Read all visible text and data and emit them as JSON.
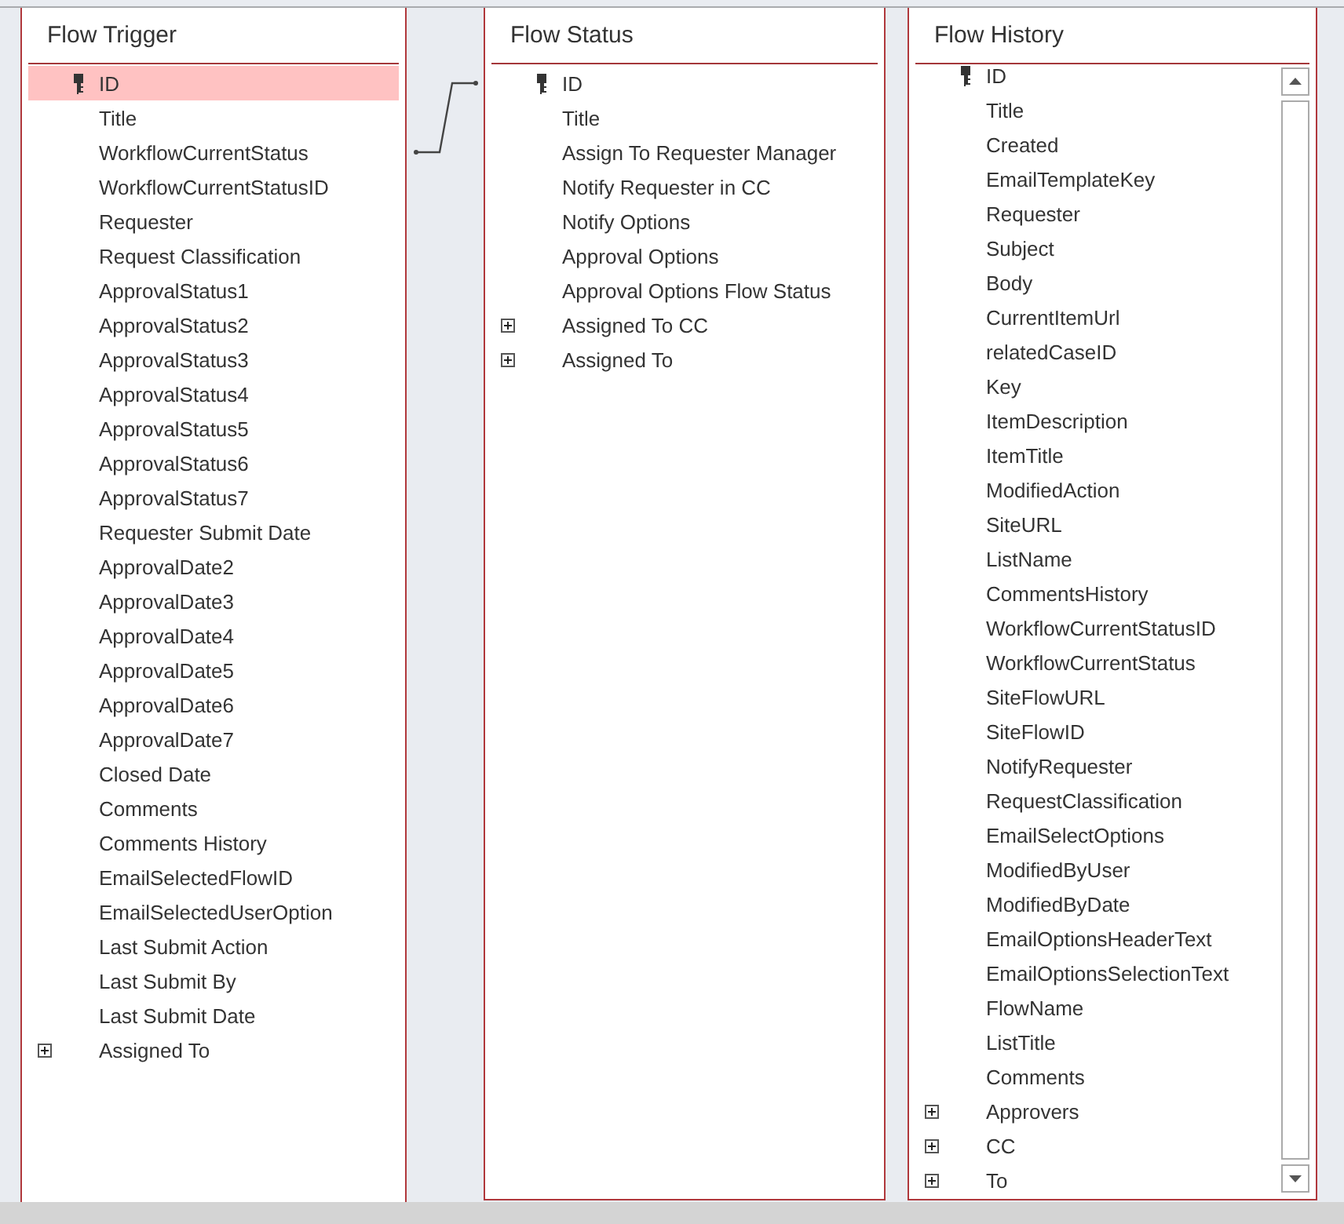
{
  "tables": [
    {
      "title": "Flow Trigger",
      "scrollbar": false,
      "fields": [
        {
          "name": "ID",
          "kind": "key",
          "selected": true
        },
        {
          "name": "Title",
          "kind": "field",
          "selected": false
        },
        {
          "name": "WorkflowCurrentStatus",
          "kind": "field",
          "selected": false
        },
        {
          "name": "WorkflowCurrentStatusID",
          "kind": "field",
          "selected": false
        },
        {
          "name": "Requester",
          "kind": "field",
          "selected": false
        },
        {
          "name": "Request Classification",
          "kind": "field",
          "selected": false
        },
        {
          "name": "ApprovalStatus1",
          "kind": "field",
          "selected": false
        },
        {
          "name": "ApprovalStatus2",
          "kind": "field",
          "selected": false
        },
        {
          "name": "ApprovalStatus3",
          "kind": "field",
          "selected": false
        },
        {
          "name": "ApprovalStatus4",
          "kind": "field",
          "selected": false
        },
        {
          "name": "ApprovalStatus5",
          "kind": "field",
          "selected": false
        },
        {
          "name": "ApprovalStatus6",
          "kind": "field",
          "selected": false
        },
        {
          "name": "ApprovalStatus7",
          "kind": "field",
          "selected": false
        },
        {
          "name": "Requester Submit Date",
          "kind": "field",
          "selected": false
        },
        {
          "name": "ApprovalDate2",
          "kind": "field",
          "selected": false
        },
        {
          "name": "ApprovalDate3",
          "kind": "field",
          "selected": false
        },
        {
          "name": "ApprovalDate4",
          "kind": "field",
          "selected": false
        },
        {
          "name": "ApprovalDate5",
          "kind": "field",
          "selected": false
        },
        {
          "name": "ApprovalDate6",
          "kind": "field",
          "selected": false
        },
        {
          "name": "ApprovalDate7",
          "kind": "field",
          "selected": false
        },
        {
          "name": "Closed Date",
          "kind": "field",
          "selected": false
        },
        {
          "name": "Comments",
          "kind": "field",
          "selected": false
        },
        {
          "name": "Comments History",
          "kind": "field",
          "selected": false
        },
        {
          "name": "EmailSelectedFlowID",
          "kind": "field",
          "selected": false
        },
        {
          "name": "EmailSelectedUserOption",
          "kind": "field",
          "selected": false
        },
        {
          "name": "Last Submit Action",
          "kind": "field",
          "selected": false
        },
        {
          "name": "Last Submit By",
          "kind": "field",
          "selected": false
        },
        {
          "name": "Last Submit Date",
          "kind": "field",
          "selected": false
        },
        {
          "name": "Assigned To",
          "kind": "multi",
          "selected": false
        }
      ]
    },
    {
      "title": "Flow Status",
      "scrollbar": false,
      "fields": [
        {
          "name": "ID",
          "kind": "key",
          "selected": false
        },
        {
          "name": "Title",
          "kind": "field",
          "selected": false
        },
        {
          "name": "Assign To Requester Manager",
          "kind": "field",
          "selected": false
        },
        {
          "name": "Notify Requester in CC",
          "kind": "field",
          "selected": false
        },
        {
          "name": "Notify Options",
          "kind": "field",
          "selected": false
        },
        {
          "name": "Approval Options",
          "kind": "field",
          "selected": false
        },
        {
          "name": "Approval Options Flow Status",
          "kind": "field",
          "selected": false
        },
        {
          "name": "Assigned To CC",
          "kind": "multi",
          "selected": false
        },
        {
          "name": "Assigned To",
          "kind": "multi",
          "selected": false
        }
      ]
    },
    {
      "title": "Flow History",
      "scrollbar": true,
      "fields": [
        {
          "name": "ID",
          "kind": "key",
          "selected": false
        },
        {
          "name": "Title",
          "kind": "field",
          "selected": false
        },
        {
          "name": "Created",
          "kind": "field",
          "selected": false
        },
        {
          "name": "EmailTemplateKey",
          "kind": "field",
          "selected": false
        },
        {
          "name": "Requester",
          "kind": "field",
          "selected": false
        },
        {
          "name": "Subject",
          "kind": "field",
          "selected": false
        },
        {
          "name": "Body",
          "kind": "field",
          "selected": false
        },
        {
          "name": "CurrentItemUrl",
          "kind": "field",
          "selected": false
        },
        {
          "name": "relatedCaseID",
          "kind": "field",
          "selected": false
        },
        {
          "name": "Key",
          "kind": "field",
          "selected": false
        },
        {
          "name": "ItemDescription",
          "kind": "field",
          "selected": false
        },
        {
          "name": "ItemTitle",
          "kind": "field",
          "selected": false
        },
        {
          "name": "ModifiedAction",
          "kind": "field",
          "selected": false
        },
        {
          "name": "SiteURL",
          "kind": "field",
          "selected": false
        },
        {
          "name": "ListName",
          "kind": "field",
          "selected": false
        },
        {
          "name": "CommentsHistory",
          "kind": "field",
          "selected": false
        },
        {
          "name": "WorkflowCurrentStatusID",
          "kind": "field",
          "selected": false
        },
        {
          "name": "WorkflowCurrentStatus",
          "kind": "field",
          "selected": false
        },
        {
          "name": "SiteFlowURL",
          "kind": "field",
          "selected": false
        },
        {
          "name": "SiteFlowID",
          "kind": "field",
          "selected": false
        },
        {
          "name": "NotifyRequester",
          "kind": "field",
          "selected": false
        },
        {
          "name": "RequestClassification",
          "kind": "field",
          "selected": false
        },
        {
          "name": "EmailSelectOptions",
          "kind": "field",
          "selected": false
        },
        {
          "name": "ModifiedByUser",
          "kind": "field",
          "selected": false
        },
        {
          "name": "ModifiedByDate",
          "kind": "field",
          "selected": false
        },
        {
          "name": "EmailOptionsHeaderText",
          "kind": "field",
          "selected": false
        },
        {
          "name": "EmailOptionsSelectionText",
          "kind": "field",
          "selected": false
        },
        {
          "name": "FlowName",
          "kind": "field",
          "selected": false
        },
        {
          "name": "ListTitle",
          "kind": "field",
          "selected": false
        },
        {
          "name": "Comments",
          "kind": "field",
          "selected": false
        },
        {
          "name": "Approvers",
          "kind": "multi",
          "selected": false
        },
        {
          "name": "CC",
          "kind": "multi",
          "selected": false
        },
        {
          "name": "To",
          "kind": "multi",
          "selected": false
        }
      ]
    }
  ]
}
